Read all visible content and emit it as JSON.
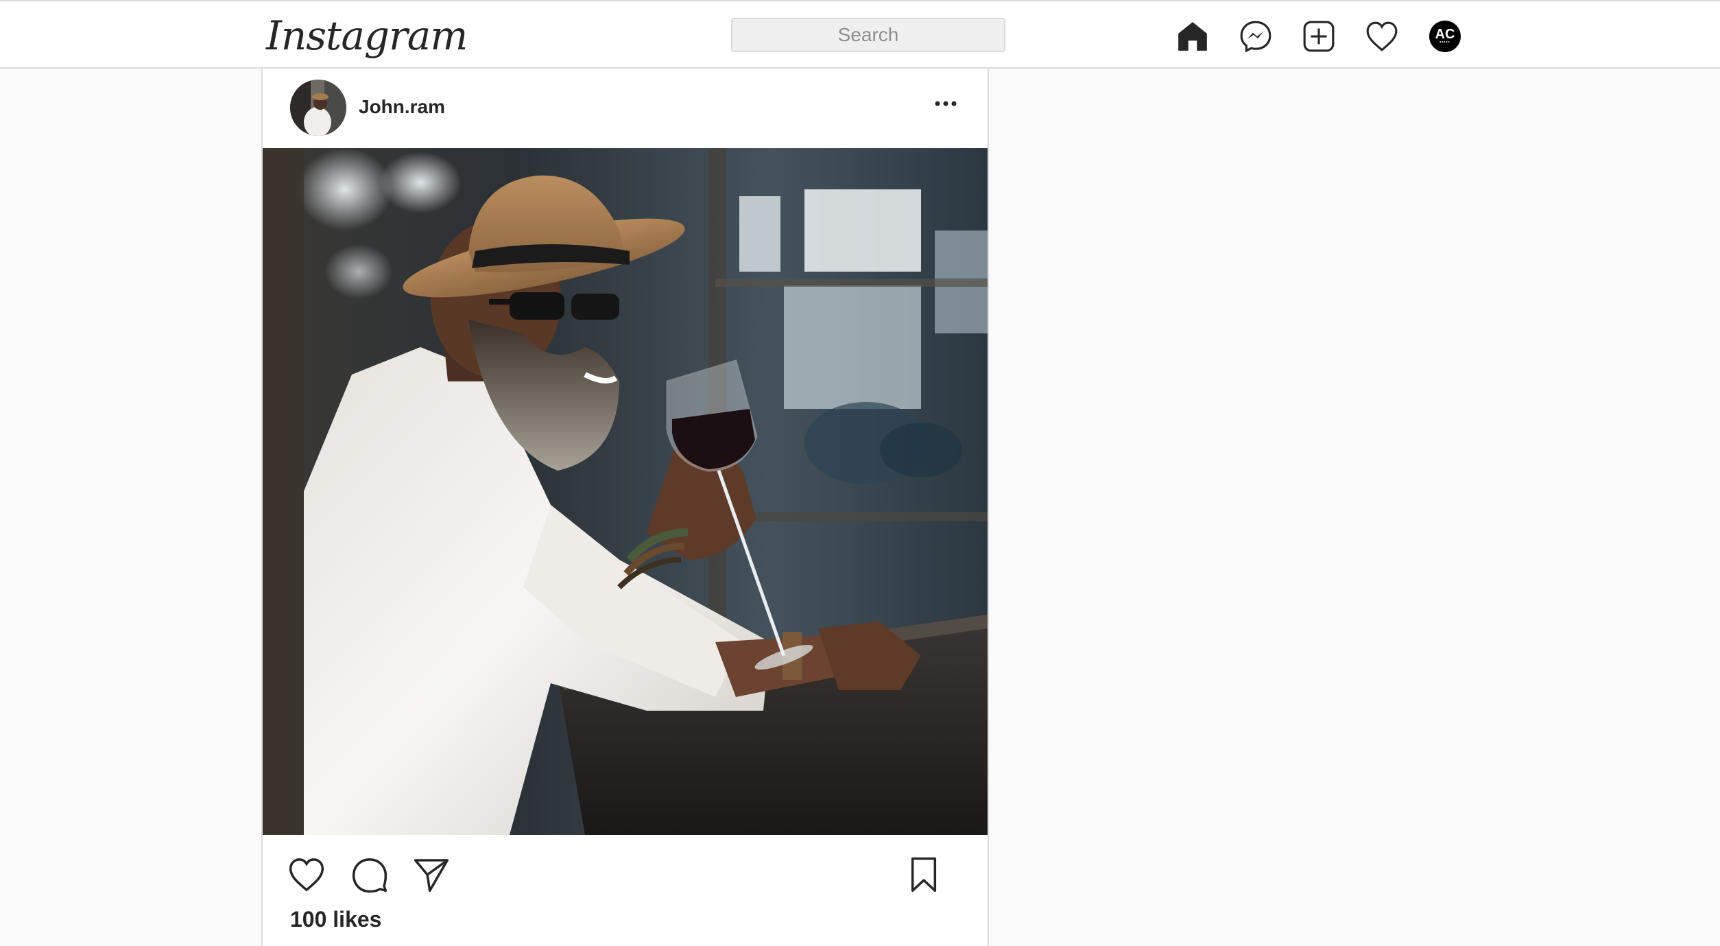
{
  "app": {
    "logo_text": "Instagram"
  },
  "search": {
    "placeholder": "Search"
  },
  "nav": {
    "icons": [
      "home-icon",
      "messenger-icon",
      "new-post-icon",
      "activity-heart-icon",
      "profile-avatar"
    ],
    "avatar_initials": "AC"
  },
  "post": {
    "username": "John.ram",
    "likes_text": "100 likes",
    "actions": [
      "like-icon",
      "comment-icon",
      "share-icon",
      "save-icon"
    ],
    "photo_subject": "photo"
  },
  "colors": {
    "border": "#dbdbdb",
    "background": "#fafafa",
    "text": "#262626",
    "muted": "#8e8e8e"
  }
}
